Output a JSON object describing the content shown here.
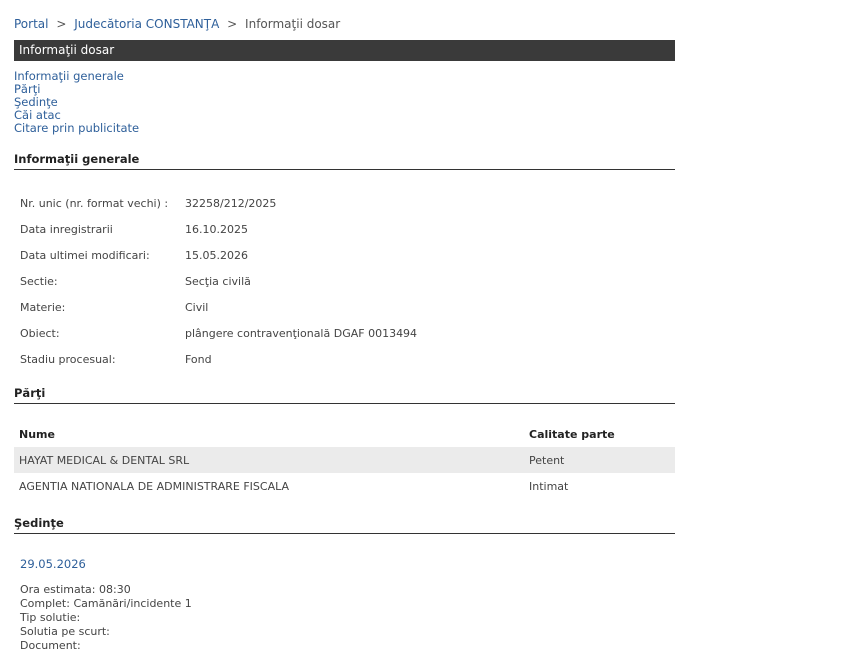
{
  "breadcrumb": {
    "portal": "Portal",
    "sep1": ">",
    "court": "Judecătoria CONSTANŢA",
    "sep2": ">",
    "current": "Informaţii dosar"
  },
  "page_title": "Informaţii dosar",
  "toc": [
    "Informaţii generale",
    "Părţi",
    "Şedinţe",
    "Căi atac",
    "Citare prin publicitate"
  ],
  "general": {
    "heading": "Informaţii generale",
    "rows": [
      {
        "label": "Nr. unic (nr. format vechi) :",
        "value": "32258/212/2025"
      },
      {
        "label": "Data inregistrarii",
        "value": "16.10.2025"
      },
      {
        "label": "Data ultimei modificari:",
        "value": "15.05.2026"
      },
      {
        "label": "Sectie:",
        "value": "Secţia civilă"
      },
      {
        "label": "Materie:",
        "value": "Civil"
      },
      {
        "label": "Obiect:",
        "value": "plângere contravenţională DGAF 0013494"
      },
      {
        "label": "Stadiu procesual:",
        "value": "Fond"
      }
    ]
  },
  "parties": {
    "heading": "Părţi",
    "col_name": "Nume",
    "col_role": "Calitate parte",
    "rows": [
      {
        "name": "HAYAT MEDICAL & DENTAL SRL",
        "role": "Petent"
      },
      {
        "name": "AGENTIA NATIONALA DE ADMINISTRARE FISCALA",
        "role": "Intimat"
      }
    ]
  },
  "hearings": {
    "heading": "Şedinţe",
    "date": "29.05.2026",
    "details": [
      "Ora estimata: 08:30",
      "Complet: Camănări/incidente 1",
      "Tip solutie:",
      "Solutia pe scurt:",
      "Document:"
    ]
  }
}
